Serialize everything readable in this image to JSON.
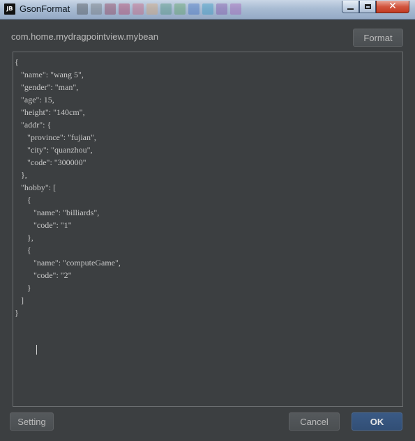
{
  "window": {
    "title": "GsonFormat",
    "app_icon": "JB",
    "controls": {
      "minimize": "minimize-icon",
      "maximize": "maximize-icon",
      "close": "close-icon"
    }
  },
  "header": {
    "class_name": "com.home.mydragpointview.mybean",
    "format_label": "Format"
  },
  "editor": {
    "text": "{\n   \"name\": \"wang 5\",\n   \"gender\": \"man\",\n   \"age\": 15,\n   \"height\": \"140cm\",\n   \"addr\": {\n      \"province\": \"fujian\",\n      \"city\": \"quanzhou\",\n      \"code\": \"300000\"\n   },\n   \"hobby\": [\n      {\n         \"name\": \"billiards\",\n         \"code\": \"1\"\n      },\n      {\n         \"name\": \"computeGame\",\n         \"code\": \"2\"\n      }\n   ]\n}"
  },
  "footer": {
    "setting_label": "Setting",
    "cancel_label": "Cancel",
    "ok_label": "OK"
  },
  "colors": {
    "background": "#3c3f41",
    "text": "#bbbbbb",
    "ok_button": "#365880"
  }
}
